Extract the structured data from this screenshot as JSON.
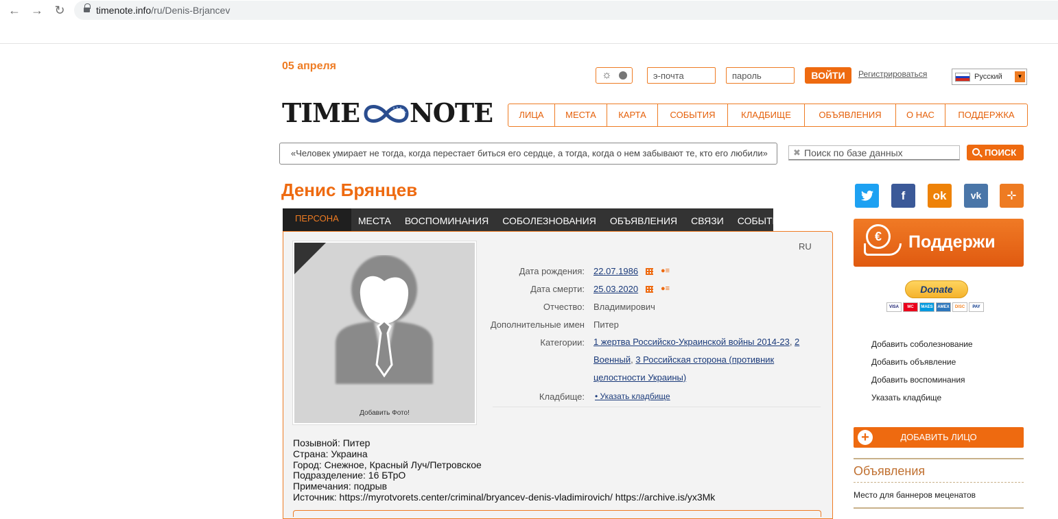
{
  "browser": {
    "url_host": "timenote.info",
    "url_path": "/ru/Denis-Brjancev"
  },
  "header": {
    "date": "05 апреля",
    "email_placeholder": "э-почта",
    "password_placeholder": "пароль",
    "login_label": "ВОЙТИ",
    "register_label": "Регистрироваться",
    "language": "Русский",
    "logo_left": "TIME",
    "logo_right": "NOTE"
  },
  "nav": [
    "ЛИЦА",
    "МЕСТА",
    "КАРТА",
    "СОБЫТИЯ",
    "КЛАДБИЩЕ",
    "ОБЪЯВЛЕНИЯ",
    "О НАС",
    "ПОДДЕРЖКА"
  ],
  "quote": "«Человек умирает не тогда, когда перестает биться его сердце, а тогда, когда о нем забывают те, кто его любили»",
  "search": {
    "placeholder": "Поиск по базе данных",
    "button": "ПОИСК"
  },
  "person": {
    "name": "Денис Брянцев",
    "lang": "RU",
    "add_photo": "Добавить Фото!",
    "tabs": [
      "ПЕРСОНА",
      "МЕСТА",
      "ВОСПОМИНАНИЯ",
      "СОБОЛЕЗНОВАНИЯ",
      "ОБЪЯВЛЕНИЯ",
      "СВЯЗИ",
      "СОБЫТИЯ"
    ],
    "fields": {
      "birth_label": "Дата рождения:",
      "birth_value": "22.07.1986",
      "death_label": "Дата смерти:",
      "death_value": "25.03.2020",
      "patronymic_label": "Отчество:",
      "patronymic_value": "Владимирович",
      "extra_names_label": "Дополнительные имен",
      "extra_names_value": "Питер",
      "categories_label": "Категории:",
      "category_1": "1 жертва Российско-Украинской войны 2014-23",
      "category_2": "2 Военный",
      "category_3a": "3 Российская сторона (противник",
      "category_3b": "целостности Украины)",
      "cemetery_label": "Кладбище:",
      "cemetery_value": "• Указать кладбище"
    },
    "bio": [
      "Позывной: Питер",
      "Страна: Украина",
      "Город: Снежное, Красный Луч/Петровское",
      "Подразделение: 16 БТрО",
      "Примечания: подрыв",
      "Источник: https://myrotvorets.center/criminal/bryancev-denis-vladimirovich/ https://archive.is/yx3Mk"
    ]
  },
  "sidebar": {
    "support_banner": "Поддержи",
    "donate": "Donate",
    "cards": [
      "VISA",
      "MC",
      "MAES",
      "AMEX",
      "DISC",
      "PAY"
    ],
    "links": [
      "Добавить соболезнование",
      "Добавить объявление",
      "Добавить воспоминания",
      "Указать кладбище"
    ],
    "add_face": "ДОБАВИТЬ ЛИЦО",
    "ads_title": "Объявления",
    "ads_text": "Место для баннеров меценатов"
  },
  "colors": {
    "accent": "#ee6a10",
    "twitter": "#1da1f2",
    "facebook": "#3b5998",
    "odnoklassniki": "#ee8208",
    "vk": "#4a76a8",
    "weibo": "#ee7b22"
  }
}
